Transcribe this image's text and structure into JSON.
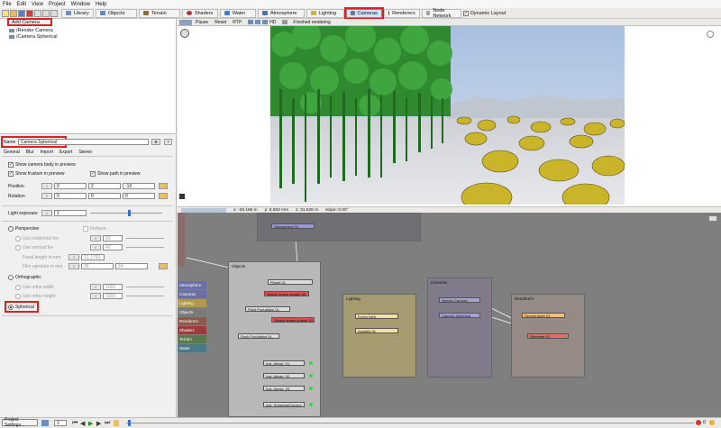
{
  "menu": [
    "File",
    "Edit",
    "View",
    "Project",
    "Window",
    "Help"
  ],
  "toolbar": {
    "tabs": [
      {
        "label": "Library",
        "color": "#6a8fc0"
      },
      {
        "label": "Objects",
        "color": "#5f8ac7"
      },
      {
        "label": "Terrain",
        "color": "#8a6a3a"
      },
      {
        "label": "Shaders",
        "color": "#c03030"
      },
      {
        "label": "Water",
        "color": "#3a7fd0"
      },
      {
        "label": "Atmosphere",
        "color": "#4a6fb0"
      },
      {
        "label": "Lighting",
        "color": "#d0b040"
      },
      {
        "label": "Cameras",
        "color": "#6a7a90"
      },
      {
        "label": "Renderers",
        "color": "#5a5a5a"
      },
      {
        "label": "Node Network",
        "color": "#a0a0a0"
      }
    ],
    "dynamic_layout": "Dynamic Layout"
  },
  "left_top": {
    "add_camera": "Add Camera",
    "tree": [
      "/Render Camera",
      "/Camera Spherical"
    ]
  },
  "panel": {
    "name_label": "Name",
    "name_value": "Camera Spherical",
    "tabs": [
      "General",
      "Blur",
      "Import",
      "Export",
      "Stereo"
    ],
    "show_body": "Show camera body in preview",
    "show_frustum": "Show frustum in preview",
    "show_path": "Show path in preview",
    "position_label": "Position",
    "position": [
      "0",
      "2",
      "-10"
    ],
    "rotation_label": "Rotation",
    "rotation": [
      "0",
      "0",
      "0"
    ],
    "light_exposure_label": "Light exposure",
    "light_exposure": "1",
    "perspective": "Perspective",
    "fisheye": "Fisheye",
    "use_hfov": "Use horizontal fov",
    "hfov": "60",
    "use_vfov": "Use vertical fov",
    "vfov": "40",
    "focal_label": "Focal length in mm",
    "focal": "31.1769",
    "film_label": "Film aperture in mm",
    "film_w": "36",
    "film_h": "24",
    "orthographic": "Orthographic",
    "use_ortho_w": "Use ortho width",
    "ortho_w": "1000",
    "use_ortho_h": "Use ortho height",
    "ortho_h": "1000",
    "spherical": "Spherical"
  },
  "viewport": {
    "buttons": [
      "Pause",
      "Reset",
      "RTP"
    ],
    "hd": "HD",
    "status": "Finished rendering"
  },
  "coords": {
    "x": "x: -28.166 m",
    "y": "y: 8.583 mm",
    "z": "z: 31.626 m",
    "slope": "slope: 0.00°"
  },
  "network": {
    "legend": [
      {
        "label": "Atmosphere",
        "color": "#6a6fa8"
      },
      {
        "label": "Cameras",
        "color": "#6a6fa8"
      },
      {
        "label": "Lighting",
        "color": "#b09a4a"
      },
      {
        "label": "Objects",
        "color": "#7a7a7a"
      },
      {
        "label": "Renderers",
        "color": "#8a5a4a"
      },
      {
        "label": "Shaders",
        "color": "#a03a3a"
      },
      {
        "label": "Terrain",
        "color": "#5a7a4a"
      },
      {
        "label": "Water",
        "color": "#4a7a8a"
      }
    ],
    "groups": {
      "objects": "Objects",
      "lighting": "Lighting",
      "cameras": "Cameras",
      "renderers": "Renderers"
    },
    "nodes": {
      "atmosphere": "Atmosphere 01",
      "planet": "Planet 01",
      "simple_shape1": "Simple shape shader 03",
      "plant_pop": "Plant Population 01",
      "simple_shape2": "Simple shape shader 01",
      "rock_pop": "Rock Population 01",
      "inst1": "Inst. Almsb_01",
      "inst2": "Inst. Almsb_02",
      "inst3": "Inst. Almsb_03",
      "inst4": "Inst. SphericalCamera",
      "enviro": "Enviro light",
      "sunlight": "Sunlight 01",
      "render_cam": "Render Camera",
      "cam_sph": "Camera Spherical",
      "render_layer": "Render layer 01",
      "renderer": "Renderer 01"
    }
  },
  "timeline": {
    "project_settings": "Project Settings...",
    "frame": "1",
    "counter": "0"
  }
}
